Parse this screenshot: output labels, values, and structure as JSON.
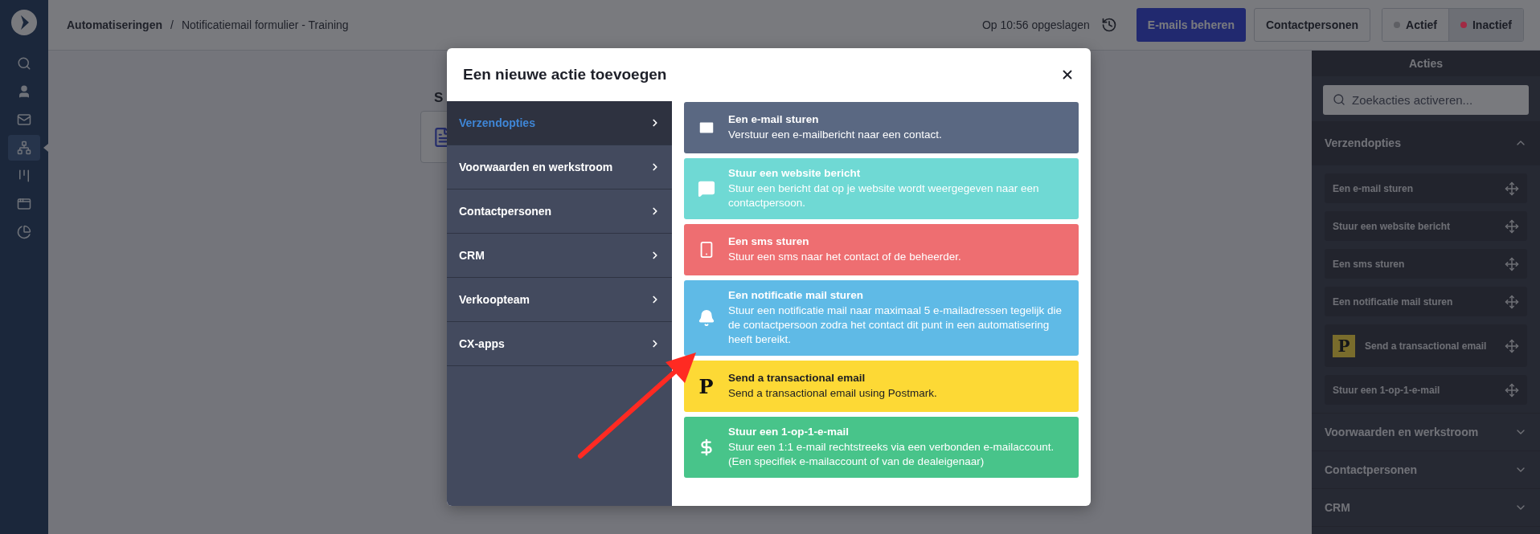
{
  "nav": {
    "items": [
      {
        "kind": "search",
        "selected": false
      },
      {
        "kind": "contacts",
        "selected": false
      },
      {
        "kind": "mail",
        "selected": false
      },
      {
        "kind": "automation",
        "selected": true
      },
      {
        "kind": "board",
        "selected": false
      },
      {
        "kind": "window",
        "selected": false
      },
      {
        "kind": "reports",
        "selected": false
      }
    ]
  },
  "header": {
    "breadcrumb_parent": "Automatiseringen",
    "breadcrumb_separator": "/",
    "breadcrumb_current": "Notificatiemail formulier - Training",
    "saved": "Op 10:56 opgeslagen",
    "primary_button": "E-mails beheren",
    "secondary_button": "Contactpersonen",
    "status_toggle": [
      {
        "label": "Actief",
        "color": "#5e5f64",
        "selected": false
      },
      {
        "label": "Inactief",
        "color": "#a12a44",
        "selected": true
      }
    ]
  },
  "canvas": {
    "node_title": "S"
  },
  "modal": {
    "title": "Een nieuwe actie toevoegen",
    "categories": [
      {
        "label": "Verzendopties",
        "selected": true
      },
      {
        "label": "Voorwaarden en werkstroom",
        "selected": false
      },
      {
        "label": "Contactpersonen",
        "selected": false
      },
      {
        "label": "CRM",
        "selected": false
      },
      {
        "label": "Verkoopteam",
        "selected": false
      },
      {
        "label": "CX-apps",
        "selected": false
      }
    ],
    "actions": [
      {
        "kind": "email",
        "color": "#5a6882",
        "text_dark": false,
        "title": "Een e-mail sturen",
        "description": "Verstuur een e-mailbericht naar een contact."
      },
      {
        "kind": "chat",
        "color": "#6fd9d4",
        "text_dark": false,
        "title": "Stuur een website bericht",
        "description": "Stuur een bericht dat op je website wordt weergegeven naar een contactpersoon."
      },
      {
        "kind": "sms",
        "color": "#ee6e71",
        "text_dark": false,
        "title": "Een sms sturen",
        "description": "Stuur een sms naar het contact of de beheerder."
      },
      {
        "kind": "bell",
        "color": "#5fbae6",
        "text_dark": false,
        "title": "Een notificatie mail sturen",
        "description": "Stuur een notificatie mail naar maximaal 5 e-mailadressen tegelijk die de contactpersoon zodra het contact dit punt in een automatisering heeft bereikt."
      },
      {
        "kind": "postmark",
        "color": "#fdd935",
        "text_dark": true,
        "logo_letter": "P",
        "title": "Send a transactional email",
        "description": "Send a transactional email using Postmark."
      },
      {
        "kind": "dollar",
        "color": "#48c48a",
        "text_dark": false,
        "title": "Stuur een 1-op-1-e-mail",
        "description": "Stuur een 1:1 e-mail rechtstreeks via een verbonden e-mailaccount. (Een specifiek e-mailaccount of van de dealeigenaar)"
      }
    ]
  },
  "sidebar": {
    "title": "Acties",
    "search_placeholder": "Zoekacties activeren...",
    "sections": [
      {
        "label": "Verzendopties",
        "expanded": true,
        "items": [
          {
            "kind": "plain",
            "label": "Een e-mail sturen"
          },
          {
            "kind": "plain",
            "label": "Stuur een website bericht"
          },
          {
            "kind": "plain",
            "label": "Een sms sturen"
          },
          {
            "kind": "plain",
            "label": "Een notificatie mail sturen"
          },
          {
            "kind": "logo",
            "logo_letter": "P",
            "label": "Send a transactional email"
          },
          {
            "kind": "plain",
            "label": "Stuur een 1-op-1-e-mail"
          }
        ]
      },
      {
        "label": "Voorwaarden en werkstroom",
        "expanded": false
      },
      {
        "label": "Contactpersonen",
        "expanded": false
      },
      {
        "label": "CRM",
        "expanded": false
      }
    ]
  }
}
